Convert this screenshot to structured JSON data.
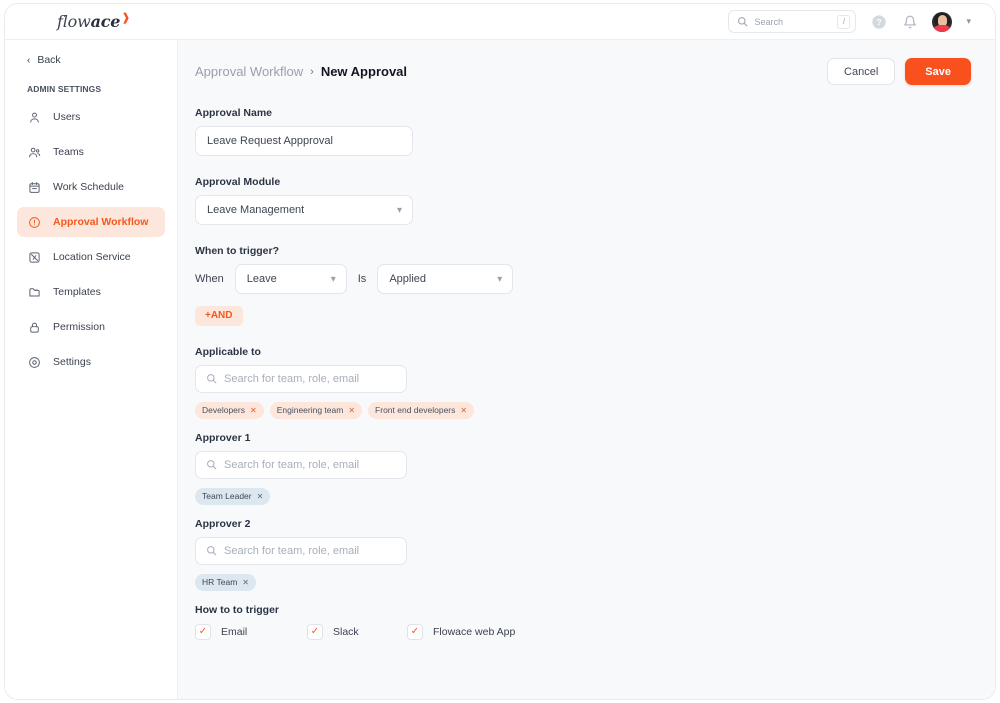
{
  "brand": {
    "logo_light": "flow",
    "logo_bold": "ace",
    "logo_mark": "❱",
    "accent_color": "#f9511e",
    "accent_soft": "#fde6dc"
  },
  "topbar": {
    "search_placeholder": "Search",
    "search_value": "",
    "search_shortcut": "/",
    "help_icon": "help-circle-icon",
    "notifications_icon": "bell-icon",
    "avatar": "user-avatar",
    "profile_chevron": "chevron-down-icon"
  },
  "sidebar": {
    "back_label": "Back",
    "section_label": "ADMIN SETTINGS",
    "items": [
      {
        "label": "Users",
        "icon": "user-icon",
        "active": false
      },
      {
        "label": "Teams",
        "icon": "users-icon",
        "active": false
      },
      {
        "label": "Work Schedule",
        "icon": "calendar-icon",
        "active": false
      },
      {
        "label": "Approval Workflow",
        "icon": "alert-circle-icon",
        "active": true
      },
      {
        "label": "Location Service",
        "icon": "location-off-icon",
        "active": false
      },
      {
        "label": "Templates",
        "icon": "folder-icon",
        "active": false
      },
      {
        "label": "Permission",
        "icon": "lock-icon",
        "active": false
      },
      {
        "label": "Settings",
        "icon": "gear-icon",
        "active": false
      }
    ]
  },
  "header": {
    "breadcrumb_parent": "Approval Workflow",
    "breadcrumb_separator": "›",
    "breadcrumb_current": "New Approval",
    "cancel_label": "Cancel",
    "save_label": "Save"
  },
  "form": {
    "approval_name": {
      "label": "Approval Name",
      "value": "Leave Request Appproval"
    },
    "approval_module": {
      "label": "Approval Module",
      "value": "Leave Management",
      "chevron": "chevron-down-icon"
    },
    "trigger": {
      "label": "When to trigger?",
      "when_label": "When",
      "when_value": "Leave",
      "is_label": "Is",
      "is_value": "Applied",
      "add_condition_label": "+AND"
    },
    "applicable_to": {
      "label": "Applicable to",
      "search_placeholder": "Search for team, role, email",
      "search_value": "",
      "chips": [
        {
          "label": "Developers",
          "remove": "✕"
        },
        {
          "label": "Engineering team",
          "remove": "✕"
        },
        {
          "label": "Front end developers",
          "remove": "✕"
        }
      ]
    },
    "approver_1": {
      "label": "Approver 1",
      "search_placeholder": "Search for team, role, email",
      "search_value": "",
      "chips": [
        {
          "label": "Team Leader",
          "remove": "✕"
        }
      ]
    },
    "approver_2": {
      "label": "Approver 2",
      "search_placeholder": "Search for team, role, email",
      "search_value": "",
      "chips": [
        {
          "label": "HR Team",
          "remove": "✕"
        }
      ]
    },
    "how_to_trigger": {
      "label": "How to to trigger",
      "options": [
        {
          "label": "Email",
          "checked": true
        },
        {
          "label": "Slack",
          "checked": true
        },
        {
          "label": "Flowace web App",
          "checked": true
        }
      ]
    }
  }
}
